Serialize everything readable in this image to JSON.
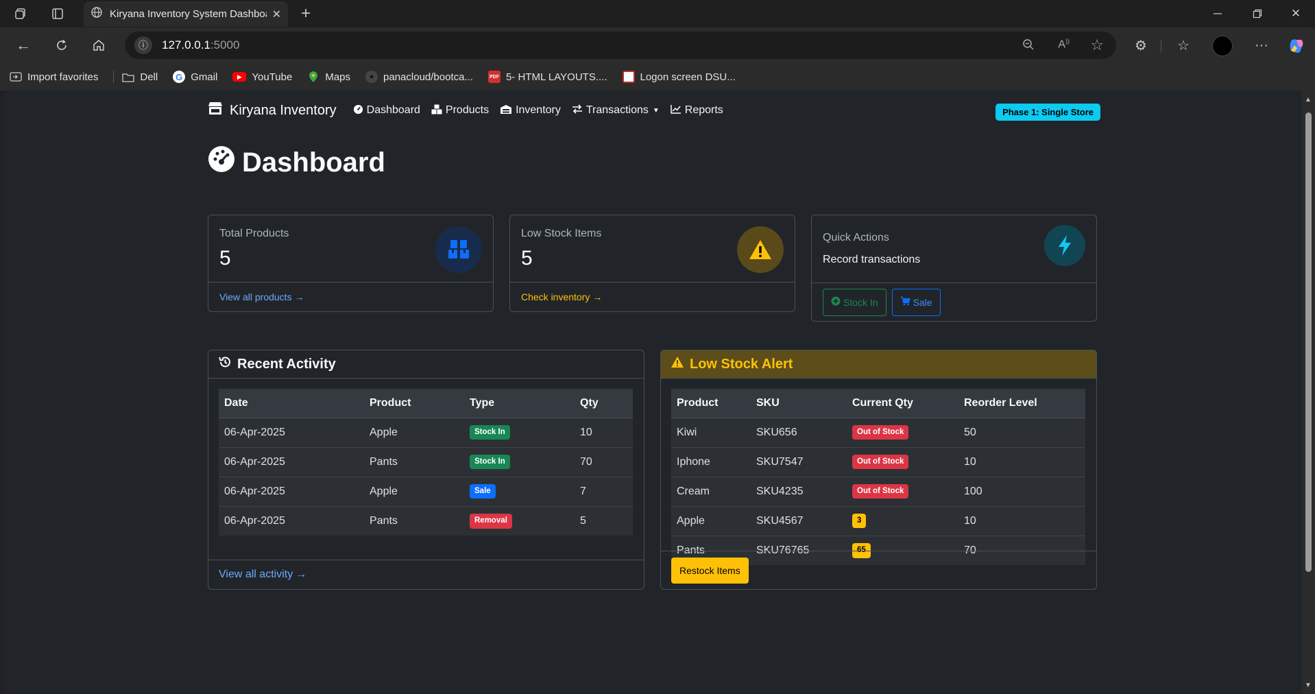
{
  "browser": {
    "tab_title": "Kiryana Inventory System Dashboard",
    "url_host": "127.0.0.1",
    "url_port": ":5000",
    "bookmarks": [
      {
        "label": "Import favorites",
        "icon": "import-icon"
      },
      {
        "label": "Dell",
        "icon": "folder-icon"
      },
      {
        "label": "Gmail",
        "icon": "google-icon"
      },
      {
        "label": "YouTube",
        "icon": "youtube-icon"
      },
      {
        "label": "Maps",
        "icon": "maps-icon"
      },
      {
        "label": "panacloud/bootca...",
        "icon": "github-icon"
      },
      {
        "label": "5- HTML LAYOUTS....",
        "icon": "pdf-icon"
      },
      {
        "label": "Logon screen DSU...",
        "icon": "page-icon"
      }
    ]
  },
  "navbar": {
    "brand": "Kiryana Inventory",
    "links": [
      "Dashboard",
      "Products",
      "Inventory",
      "Transactions",
      "Reports"
    ],
    "phase_badge": "Phase 1: Single Store"
  },
  "page": {
    "title": "Dashboard"
  },
  "cards": {
    "total_products": {
      "label": "Total Products",
      "value": "5",
      "link": "View all products"
    },
    "low_stock": {
      "label": "Low Stock Items",
      "value": "5",
      "link": "Check inventory"
    },
    "quick_actions": {
      "label": "Quick Actions",
      "subtitle": "Record transactions",
      "stock_in": "Stock In",
      "sale": "Sale"
    }
  },
  "recent_activity": {
    "title": "Recent Activity",
    "columns": [
      "Date",
      "Product",
      "Type",
      "Qty"
    ],
    "rows": [
      {
        "date": "06-Apr-2025",
        "product": "Apple",
        "type": "Stock In",
        "qty": "10"
      },
      {
        "date": "06-Apr-2025",
        "product": "Pants",
        "type": "Stock In",
        "qty": "70"
      },
      {
        "date": "06-Apr-2025",
        "product": "Apple",
        "type": "Sale",
        "qty": "7"
      },
      {
        "date": "06-Apr-2025",
        "product": "Pants",
        "type": "Removal",
        "qty": "5"
      }
    ],
    "footer_link": "View all activity"
  },
  "low_stock_alert": {
    "title": "Low Stock Alert",
    "columns": [
      "Product",
      "SKU",
      "Current Qty",
      "Reorder Level"
    ],
    "rows": [
      {
        "product": "Kiwi",
        "sku": "SKU656",
        "qty": "Out of Stock",
        "reorder": "50"
      },
      {
        "product": "Iphone",
        "sku": "SKU7547",
        "qty": "Out of Stock",
        "reorder": "10"
      },
      {
        "product": "Cream",
        "sku": "SKU4235",
        "qty": "Out of Stock",
        "reorder": "100"
      },
      {
        "product": "Apple",
        "sku": "SKU4567",
        "qty": "3",
        "reorder": "10"
      },
      {
        "product": "Pants",
        "sku": "SKU76765",
        "qty": "65",
        "reorder": "70"
      }
    ],
    "restock_button": "Restock Items"
  },
  "colors": {
    "success": "#198754",
    "primary": "#0d6efd",
    "danger": "#dc3545",
    "warning": "#ffc107",
    "info": "#0dcaf0"
  }
}
